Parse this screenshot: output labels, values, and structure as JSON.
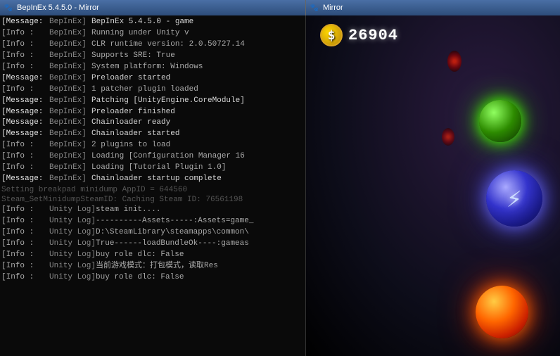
{
  "titleLeft": {
    "text": "BepInEx 5.4.5.0 - Mirror",
    "icon": "🐾"
  },
  "titleRight": {
    "text": "Mirror",
    "icon": "🐾"
  },
  "console": {
    "lines": [
      {
        "type": "message",
        "label": "[Message:",
        "source": "  BepInEx]",
        "msg": "BepInEx 5.4.5.0 - game"
      },
      {
        "type": "info",
        "label": "[Info    :",
        "source": "  BepInEx]",
        "msg": "Running under Unity v"
      },
      {
        "type": "info",
        "label": "[Info    :",
        "source": "  BepInEx]",
        "msg": "CLR runtime version: 2.0.50727.14"
      },
      {
        "type": "info",
        "label": "[Info    :",
        "source": "  BepInEx]",
        "msg": "Supports SRE: True"
      },
      {
        "type": "info",
        "label": "[Info    :",
        "source": "  BepInEx]",
        "msg": "System platform: Windows"
      },
      {
        "type": "message",
        "label": "[Message:",
        "source": "  BepInEx]",
        "msg": "Preloader started"
      },
      {
        "type": "info",
        "label": "[Info    :",
        "source": "  BepInEx]",
        "msg": "1 patcher plugin loaded"
      },
      {
        "type": "message",
        "label": "[Message:",
        "source": "  BepInEx]",
        "msg": "Patching [UnityEngine.CoreModule]"
      },
      {
        "type": "message",
        "label": "[Message:",
        "source": "  BepInEx]",
        "msg": "Preloader finished"
      },
      {
        "type": "message",
        "label": "[Message:",
        "source": "  BepInEx]",
        "msg": "Chainloader ready"
      },
      {
        "type": "message",
        "label": "[Message:",
        "source": "  BepInEx]",
        "msg": "Chainloader started"
      },
      {
        "type": "info",
        "label": "[Info    :",
        "source": "  BepInEx]",
        "msg": "2 plugins to load"
      },
      {
        "type": "info",
        "label": "[Info    :",
        "source": "  BepInEx]",
        "msg": "Loading [Configuration Manager 16"
      },
      {
        "type": "info",
        "label": "[Info    :",
        "source": "  BepInEx]",
        "msg": "Loading [Tutorial Plugin 1.0]"
      },
      {
        "type": "message",
        "label": "[Message:",
        "source": "  BepInEx]",
        "msg": "Chainloader startup complete"
      },
      {
        "type": "sep",
        "label": "",
        "source": "",
        "msg": "Setting breakpad minidump AppID = 644560"
      },
      {
        "type": "sep",
        "label": "",
        "source": "",
        "msg": "Steam_SetMinidumpSteamID:  Caching Steam ID:  76561198"
      },
      {
        "type": "info",
        "label": "[Info    :",
        "source": "  Unity Log]",
        "msg": "steam init...."
      },
      {
        "type": "info",
        "label": "[Info    :",
        "source": "  Unity Log]",
        "msg": "----------Assets-----:Assets=game_"
      },
      {
        "type": "info",
        "label": "[Info    :",
        "source": "  Unity Log]",
        "msg": "D:\\SteamLibrary\\steamapps\\common\\"
      },
      {
        "type": "info",
        "label": "[Info    :",
        "source": "  Unity Log]",
        "msg": "True------loadBundleOk----:gameas"
      },
      {
        "type": "info",
        "label": "[Info    :",
        "source": "  Unity Log]",
        "msg": "buy role dlc: False"
      },
      {
        "type": "info",
        "label": "[Info    :",
        "source": "  Unity Log]",
        "msg": "当前游戏模式：打包模式，读取Res"
      },
      {
        "type": "info",
        "label": "[Info    :",
        "source": "  Unity Log]",
        "msg": "buy role dlc: False"
      }
    ]
  },
  "game": {
    "coinValue": "26904",
    "coinSymbol": "$"
  }
}
